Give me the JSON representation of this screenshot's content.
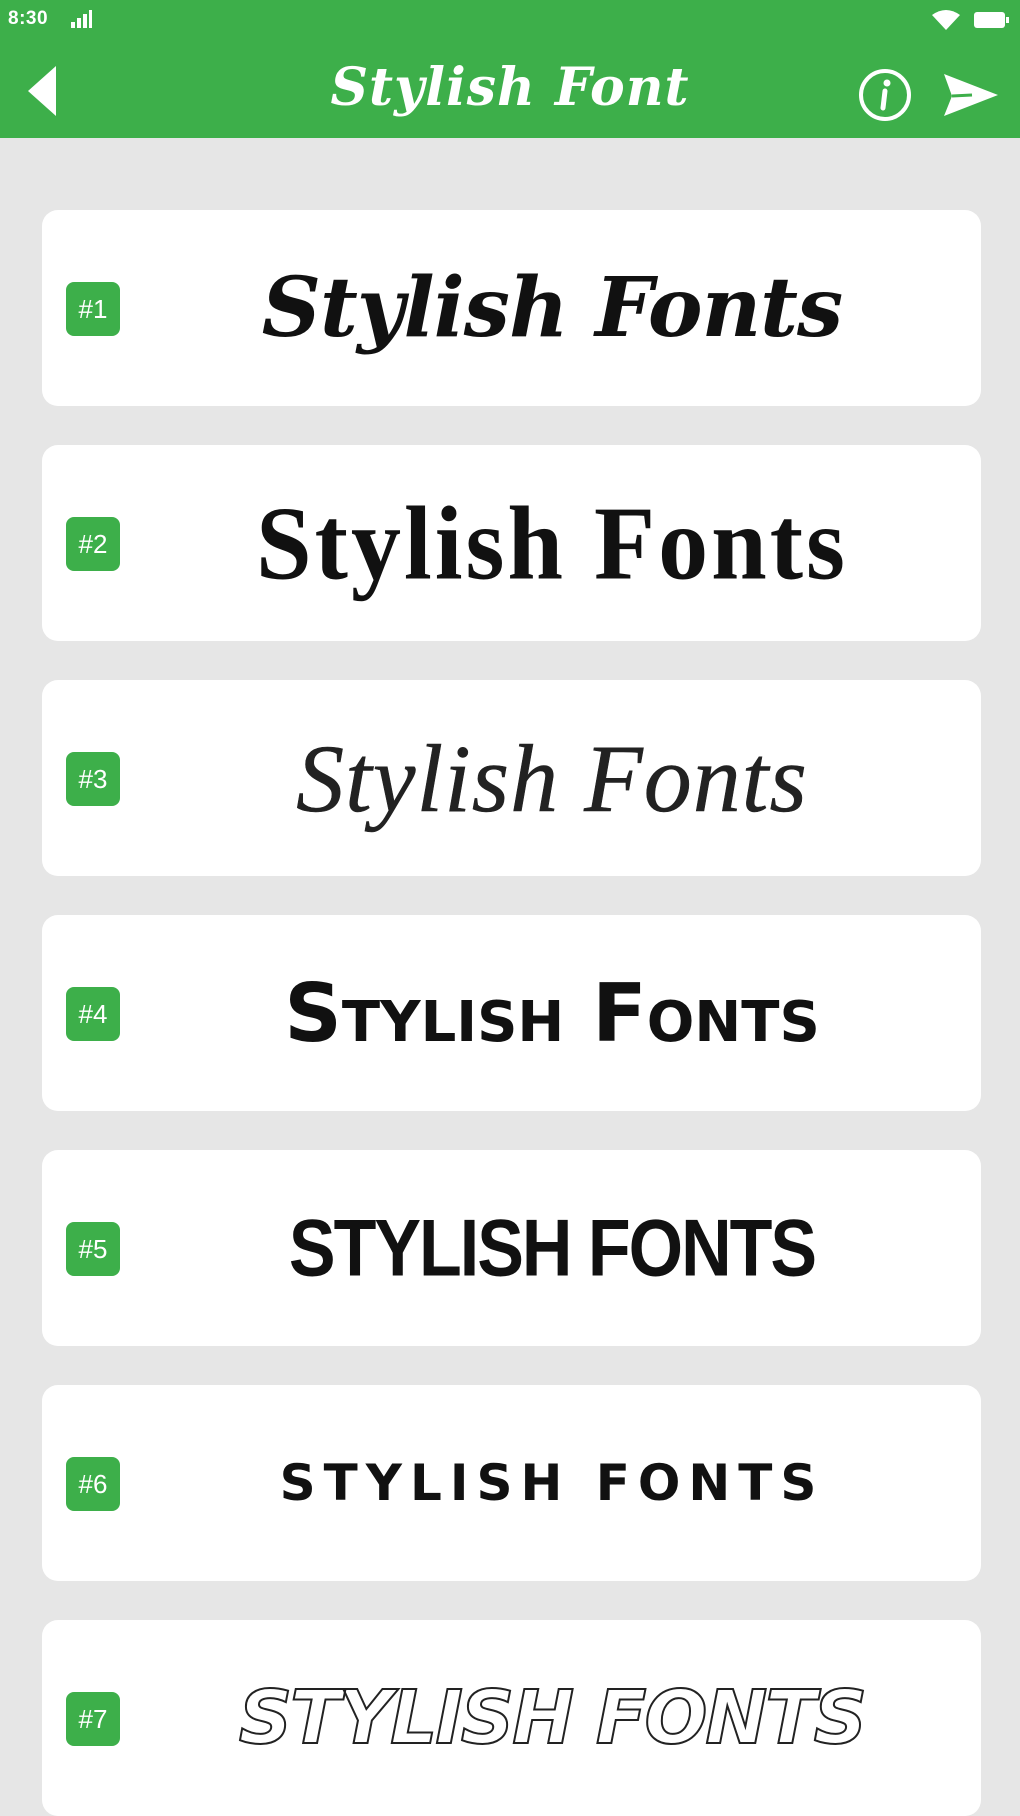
{
  "status_bar": {
    "time": "8:30",
    "icons": [
      "signal-icon",
      "wifi-icon",
      "battery-icon"
    ]
  },
  "app_bar": {
    "title": "Stylish Font",
    "icons": [
      "back-arrow-icon",
      "info-icon",
      "send-icon"
    ],
    "color": "#3daf4a"
  },
  "font_list": [
    {
      "badge": "#1",
      "sample": "Stylish Fonts"
    },
    {
      "badge": "#2",
      "sample": "Stylish Fonts"
    },
    {
      "badge": "#3",
      "sample": "Stylish Fonts"
    },
    {
      "badge": "#4",
      "sample": "Stylish Fonts"
    },
    {
      "badge": "#5",
      "sample": "STYLISH FONTS"
    },
    {
      "badge": "#6",
      "sample": "STYLISH FONTS"
    },
    {
      "badge": "#7",
      "sample": "STYLISH FONTS"
    }
  ],
  "colors": {
    "accent": "#3daf4a",
    "background": "#e6e6e6",
    "card": "#ffffff"
  }
}
